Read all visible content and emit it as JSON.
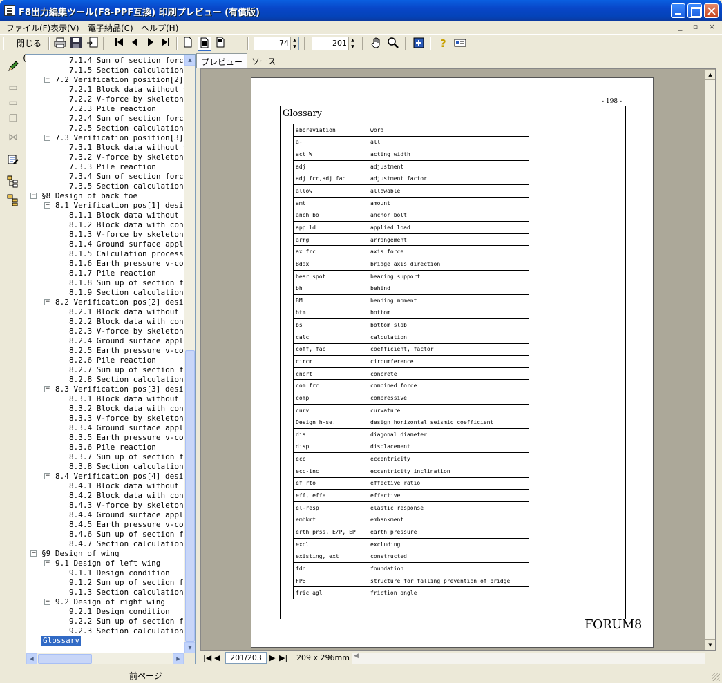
{
  "window": {
    "title": "F8出力編集ツール(F8-PPF互換) 印刷プレビュー (有償版)"
  },
  "menubar": {
    "items": [
      "ファイル(F)",
      "表示(V)",
      "電子納品(C)",
      "ヘルプ(H)"
    ]
  },
  "toolbar": {
    "close_label": "閉じる(X)",
    "page_value": "74",
    "zoom_value": "201"
  },
  "tree": {
    "rows": [
      "7.1.4 Sum of section force",
      "7.1.5 Section calculation",
      "7.2 Verification position[2] de",
      "7.2.1 Block data without wa",
      "7.2.2 V-force by skeleton se",
      "7.2.3 Pile reaction",
      "7.2.4 Sum of section force",
      "7.2.5 Section calculation",
      "7.3 Verification position[3] de",
      "7.3.1 Block data without wa",
      "7.3.2 V-force by skeleton se",
      "7.3.3 Pile reaction",
      "7.3.4 Sum of section force",
      "7.3.5 Section calculation",
      "§8 Design of back toe",
      "8.1 Verification pos[1] design",
      "8.1.1 Block data without cor",
      "8.1.2 Block data with consic",
      "8.1.3 V-force by skeleton se",
      "8.1.4 Ground surface appliec",
      "8.1.5 Calculation process of",
      "8.1.6 Earth pressure v-compc",
      "8.1.7 Pile reaction",
      "8.1.8 Sum up of section forc",
      "8.1.9 Section calculation",
      "8.2 Verification pos[2] design",
      "8.2.1 Block data without cor",
      "8.2.2 Block data with consic",
      "8.2.3 V-force by skeleton se",
      "8.2.4 Ground surface appliec",
      "8.2.5 Earth pressure v-compc",
      "8.2.6 Pile reaction",
      "8.2.7 Sum up of section forc",
      "8.2.8 Section calculation",
      "8.3 Verification pos[3] design",
      "8.3.1 Block data without cor",
      "8.3.2 Block data with consic",
      "8.3.3 V-force by skeleton se",
      "8.3.4 Ground surface appliec",
      "8.3.5 Earth pressure v-compc",
      "8.3.6 Pile reaction",
      "8.3.7 Sum up of section forc",
      "8.3.8 Section calculation",
      "8.4 Verification pos[4] design",
      "8.4.1 Block data without cor",
      "8.4.2 Block data with consic",
      "8.4.3 V-force by skeleton se",
      "8.4.4 Ground surface appliec",
      "8.4.5 Earth pressure v-compc",
      "8.4.6 Sum up of section forc",
      "8.4.7 Section calculation",
      "§9 Design of wing",
      "9.1 Design of left wing",
      "9.1.1 Design condition",
      "9.1.2 Sum up of section forc",
      "9.1.3 Section calculation",
      "9.2 Design of right wing",
      "9.2.1 Design condition",
      "9.2.2 Sum up of section forc",
      "9.2.3 Section calculation",
      "Glossary"
    ]
  },
  "tabs": [
    "プレビュー",
    "ソース"
  ],
  "page": {
    "number": "- 198 -",
    "heading": "Glossary",
    "brand": "FORUM8",
    "glossary": [
      [
        "abbreviation",
        "word"
      ],
      [
        "a-",
        "all"
      ],
      [
        "act W",
        "acting width"
      ],
      [
        "adj",
        "adjustment"
      ],
      [
        "adj fcr,adj fac",
        "adjustment factor"
      ],
      [
        "allow",
        "allowable"
      ],
      [
        "amt",
        "amount"
      ],
      [
        "anch bo",
        "anchor bolt"
      ],
      [
        "app ld",
        "applied load"
      ],
      [
        "arrg",
        "arrangement"
      ],
      [
        "ax frc",
        "axis force"
      ],
      [
        "Bdax",
        "bridge axis direction"
      ],
      [
        "bear spot",
        "bearing support"
      ],
      [
        "bh",
        "behind"
      ],
      [
        "BM",
        "bending moment"
      ],
      [
        "btm",
        "bottom"
      ],
      [
        "bs",
        "bottom slab"
      ],
      [
        "calc",
        "calculation"
      ],
      [
        "coff, fac",
        "coefficient, factor"
      ],
      [
        "circm",
        "circumference"
      ],
      [
        "cncrt",
        "concrete"
      ],
      [
        "com frc",
        "combined force"
      ],
      [
        "comp",
        "compressive"
      ],
      [
        "curv",
        "curvature"
      ],
      [
        "Design h-se.",
        "design horizontal seismic coefficient"
      ],
      [
        "dia",
        "diagonal diameter"
      ],
      [
        "disp",
        "displacement"
      ],
      [
        "ecc",
        "eccentricity"
      ],
      [
        "ecc-inc",
        "eccentricity inclination"
      ],
      [
        "ef rto",
        "effective ratio"
      ],
      [
        "eff, effe",
        "effective"
      ],
      [
        "el-resp",
        "elastic response"
      ],
      [
        "embkmt",
        "embankment"
      ],
      [
        "erth prss, E/P, EP",
        "earth pressure"
      ],
      [
        "excl",
        "excluding"
      ],
      [
        "existing, ext",
        "constructed"
      ],
      [
        "fdn",
        "foundation"
      ],
      [
        "FPB",
        "structure for falling prevention of bridge"
      ],
      [
        "fric agl",
        "friction angle"
      ]
    ]
  },
  "nav": {
    "page_box": "201/203",
    "paper_size": "209 x 296mm"
  },
  "status": {
    "text": "前ページ"
  }
}
